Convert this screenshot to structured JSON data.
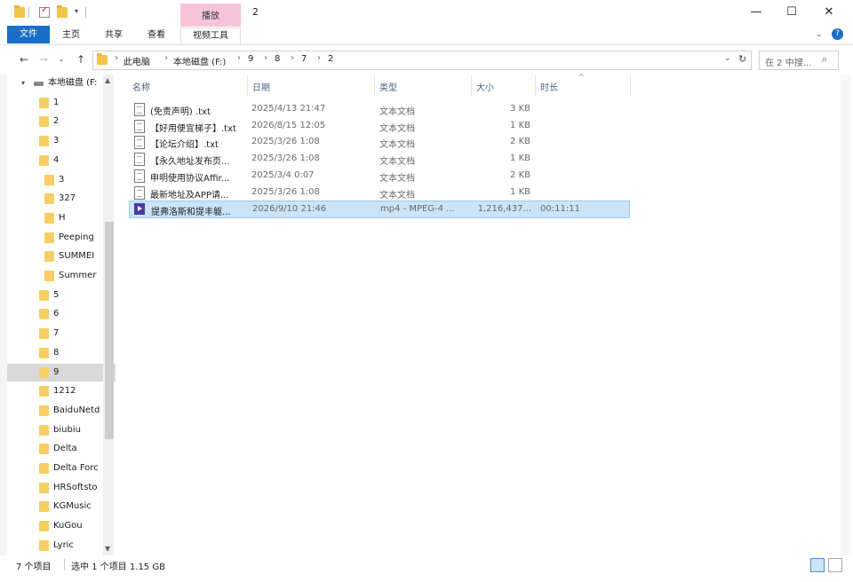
{
  "window": {
    "title": "2",
    "context_tab": "播放"
  },
  "ribbon": {
    "tabs": [
      "文件",
      "主页",
      "共享",
      "查看",
      "视频工具"
    ]
  },
  "address": {
    "crumbs": [
      "此电脑",
      "本地磁盘 (F:)",
      "9",
      "8",
      "7",
      "2"
    ],
    "search_placeholder": "在 2 中搜..."
  },
  "nav": {
    "items": [
      {
        "label": "本地磁盘 (F:",
        "indent": 0,
        "drive": true
      },
      {
        "label": "1",
        "indent": 1
      },
      {
        "label": "2",
        "indent": 1
      },
      {
        "label": "3",
        "indent": 1
      },
      {
        "label": "4",
        "indent": 1
      },
      {
        "label": "3",
        "indent": 2
      },
      {
        "label": "327",
        "indent": 2
      },
      {
        "label": "H",
        "indent": 2
      },
      {
        "label": "Peeping",
        "indent": 2
      },
      {
        "label": "SUMMEI",
        "indent": 2
      },
      {
        "label": "Summer",
        "indent": 2
      },
      {
        "label": "5",
        "indent": 1
      },
      {
        "label": "6",
        "indent": 1
      },
      {
        "label": "7",
        "indent": 1
      },
      {
        "label": "8",
        "indent": 1
      },
      {
        "label": "9",
        "indent": 1,
        "selected": true
      },
      {
        "label": "1212",
        "indent": 1
      },
      {
        "label": "BaiduNetd",
        "indent": 1
      },
      {
        "label": "biubiu",
        "indent": 1
      },
      {
        "label": "Delta",
        "indent": 1
      },
      {
        "label": "Delta Forc",
        "indent": 1
      },
      {
        "label": "HRSoftsto",
        "indent": 1
      },
      {
        "label": "KGMusic",
        "indent": 1
      },
      {
        "label": "KuGou",
        "indent": 1
      },
      {
        "label": "Lyric",
        "indent": 1
      }
    ]
  },
  "columns": {
    "name": "名称",
    "date": "日期",
    "type": "类型",
    "size": "大小",
    "duration": "时长"
  },
  "files": [
    {
      "name": "(免责声明) .txt",
      "date": "2025/4/13 21:47",
      "type": "文本文档",
      "size": "3 KB",
      "duration": "",
      "kind": "txt"
    },
    {
      "name": "【好用便宜梯子】.txt",
      "date": "2026/8/15 12:05",
      "type": "文本文档",
      "size": "1 KB",
      "duration": "",
      "kind": "txt"
    },
    {
      "name": "【论坛介绍】.txt",
      "date": "2025/3/26 1:08",
      "type": "文本文档",
      "size": "2 KB",
      "duration": "",
      "kind": "txt"
    },
    {
      "name": "【永久地址发布页...",
      "date": "2025/3/26 1:08",
      "type": "文本文档",
      "size": "1 KB",
      "duration": "",
      "kind": "txt"
    },
    {
      "name": "申明使用协议Affir...",
      "date": "2025/3/4 0:07",
      "type": "文本文档",
      "size": "2 KB",
      "duration": "",
      "kind": "txt"
    },
    {
      "name": "最新地址及APP请...",
      "date": "2025/3/26 1:08",
      "type": "文本文档",
      "size": "1 KB",
      "duration": "",
      "kind": "txt"
    },
    {
      "name": "提弗洛斯和提丰躯...",
      "date": "2026/9/10 21:46",
      "type": "mp4 - MPEG-4 ...",
      "size": "1,216,437...",
      "duration": "00:11:11",
      "kind": "video",
      "selected": true
    }
  ],
  "status": {
    "count": "7 个项目",
    "selected": "选中 1 个项目  1.15 GB"
  }
}
